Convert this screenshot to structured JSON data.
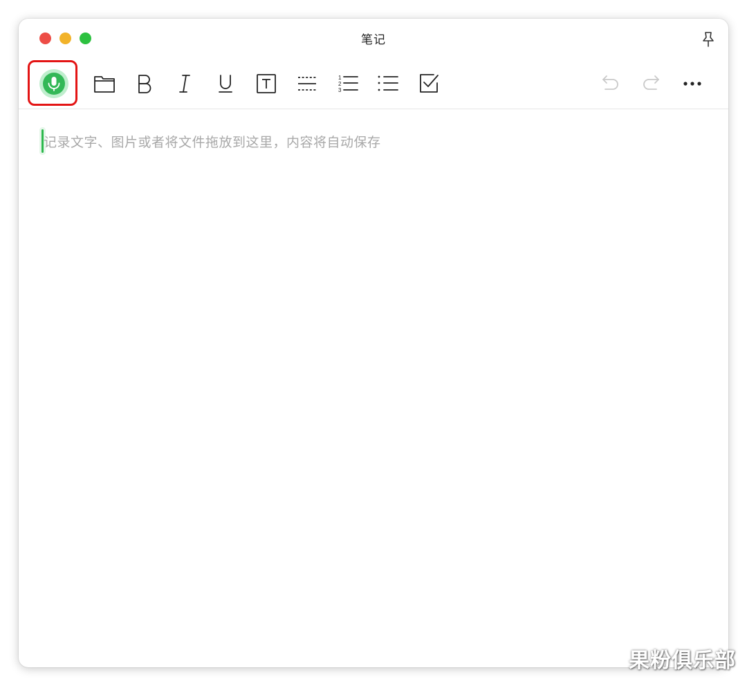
{
  "window": {
    "title": "笔记"
  },
  "toolbar": {
    "buttons": [
      {
        "name": "voice-input",
        "icon": "microphone-icon"
      },
      {
        "name": "attach-file",
        "icon": "folder-icon"
      },
      {
        "name": "bold",
        "icon": "bold-icon"
      },
      {
        "name": "italic",
        "icon": "italic-icon"
      },
      {
        "name": "underline",
        "icon": "underline-icon"
      },
      {
        "name": "text-box",
        "icon": "text-box-icon"
      },
      {
        "name": "divider-line",
        "icon": "dashed-divider-icon"
      },
      {
        "name": "numbered-list",
        "icon": "numbered-list-icon"
      },
      {
        "name": "bulleted-list",
        "icon": "bulleted-list-icon"
      },
      {
        "name": "checklist",
        "icon": "checkbox-icon"
      },
      {
        "name": "undo",
        "icon": "undo-icon"
      },
      {
        "name": "redo",
        "icon": "redo-icon"
      },
      {
        "name": "more",
        "icon": "more-icon"
      }
    ]
  },
  "editor": {
    "placeholder": "记录文字、图片或者将文件拖放到这里，内容将自动保存"
  },
  "watermark": {
    "text": "果粉俱乐部"
  },
  "colors": {
    "accent_green": "#2db84d",
    "highlight_red": "#e31414",
    "close": "#ed4d46",
    "minimize": "#f2b32a",
    "maximize": "#2dc140"
  }
}
